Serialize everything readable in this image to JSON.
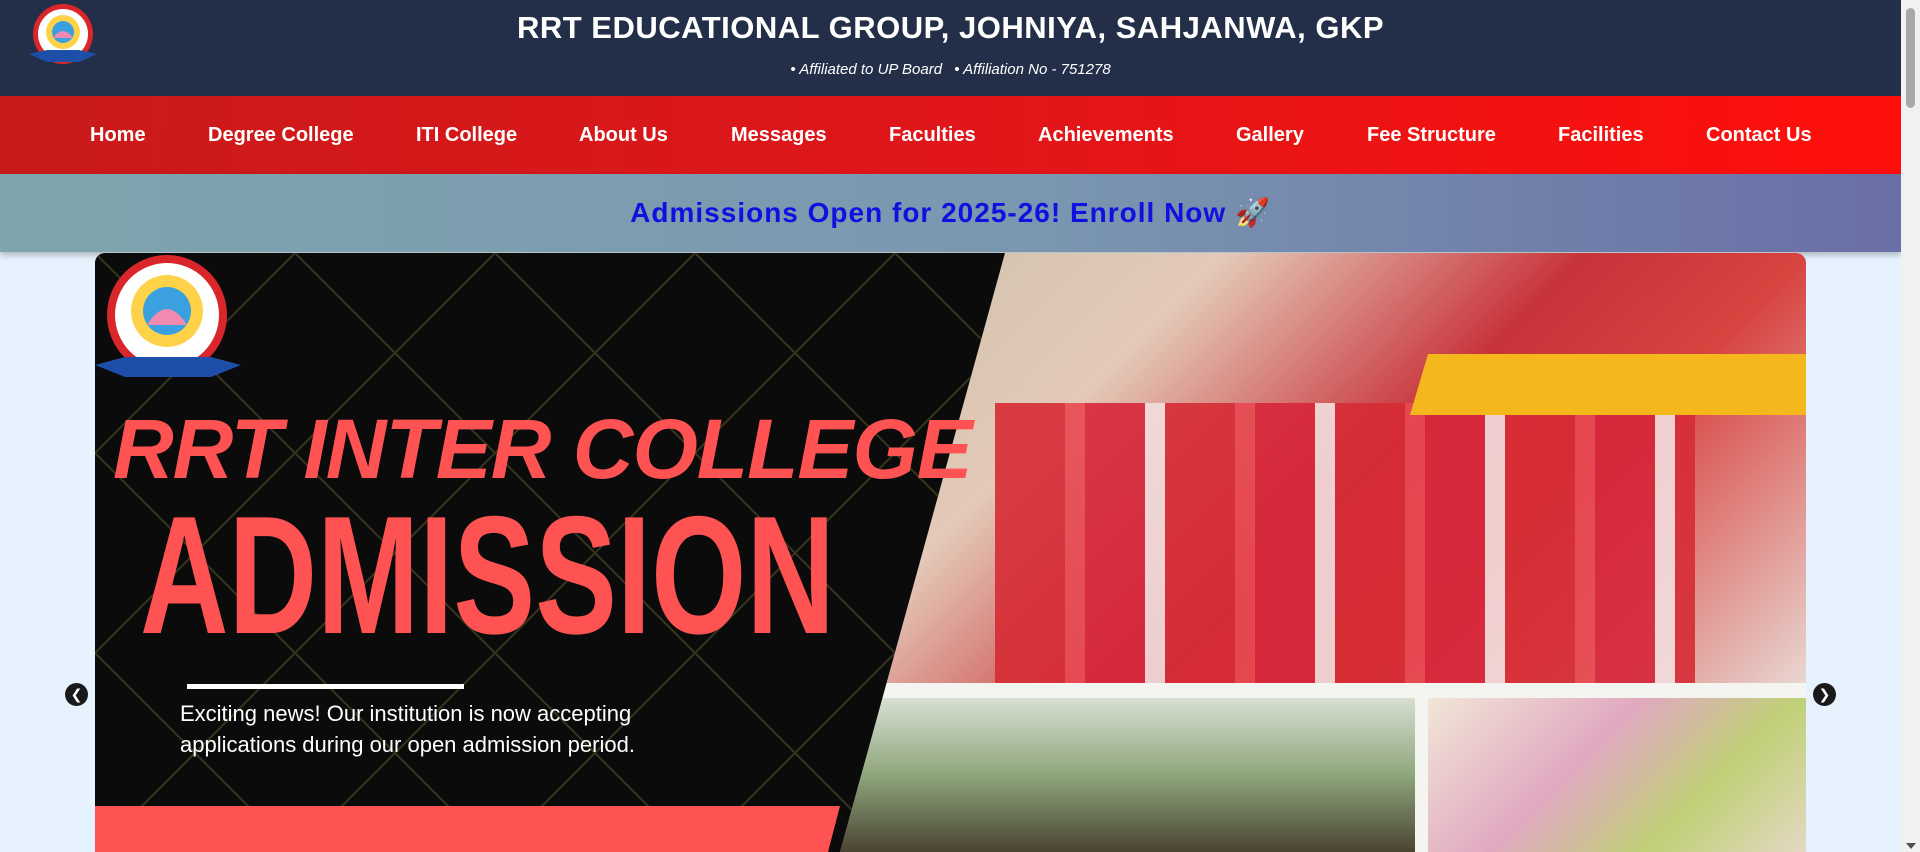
{
  "header": {
    "title": "RRT EDUCATIONAL GROUP, JOHNIYA, SAHJANWA, GKP",
    "affiliation_board": "• Affiliated to UP Board",
    "affiliation_no": "• Affiliation No - 751278"
  },
  "nav": {
    "items": [
      {
        "label": "Home"
      },
      {
        "label": "Degree College"
      },
      {
        "label": "ITI College"
      },
      {
        "label": "About Us"
      },
      {
        "label": "Messages"
      },
      {
        "label": "Faculties"
      },
      {
        "label": "Achievements"
      },
      {
        "label": "Gallery"
      },
      {
        "label": "Fee Structure"
      },
      {
        "label": "Facilities"
      },
      {
        "label": "Contact Us"
      }
    ]
  },
  "banner": {
    "text": "Admissions Open for 2025-26! Enroll Now 🚀"
  },
  "slide": {
    "headline": "RRT INTER COLLEGE",
    "big_word": "ADMISSION",
    "description": "Exciting news! Our institution is now accepting applications during our open admission period."
  },
  "slider_controls": {
    "prev_icon": "chevron-left-icon",
    "next_icon": "chevron-right-icon"
  },
  "colors": {
    "header_bg": "#232f48",
    "nav_red": "#e0161a",
    "banner_text": "#1010e0",
    "accent_coral": "#ff5252",
    "accent_yellow": "#f4b81d"
  }
}
